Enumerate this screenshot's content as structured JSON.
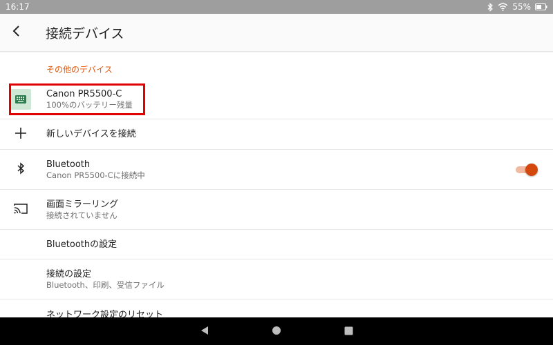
{
  "status_bar": {
    "time": "16:17",
    "battery": "55%",
    "icons": [
      "bluetooth-icon",
      "wifi-icon",
      "battery-icon"
    ]
  },
  "app_bar": {
    "title": "接続デバイス",
    "back_icon": "back-arrow-icon"
  },
  "section_other_devices": {
    "header": "その他のデバイス",
    "device": {
      "name": "Canon PR5500-C",
      "subtitle": "100%のバッテリー残量",
      "icon": "keyboard-icon"
    }
  },
  "items": {
    "new_device": {
      "label": "新しいデバイスを接続",
      "icon": "plus-icon"
    },
    "bluetooth": {
      "label": "Bluetooth",
      "subtitle": "Canon PR5500-Cに接続中",
      "icon": "bluetooth-icon",
      "enabled": true
    },
    "screen_mirroring": {
      "label": "画面ミラーリング",
      "subtitle": "接続されていません",
      "icon": "cast-icon"
    },
    "bluetooth_settings": {
      "label": "Bluetoothの設定"
    },
    "connection_settings": {
      "label": "接続の設定",
      "subtitle": "Bluetooth、印刷、受信ファイル"
    },
    "network_reset": {
      "label": "ネットワーク設定のリセット"
    }
  },
  "colors": {
    "accent": "#e0570d",
    "toggle_thumb": "#d4480d",
    "toggle_track": "#f0b9a0",
    "highlight": "#e00000",
    "status_bar": "#9e9e9e",
    "nav_bar": "#000000"
  },
  "nav_bar": {
    "icons": [
      "back-triangle-icon",
      "home-circle-icon",
      "recents-square-icon"
    ]
  }
}
